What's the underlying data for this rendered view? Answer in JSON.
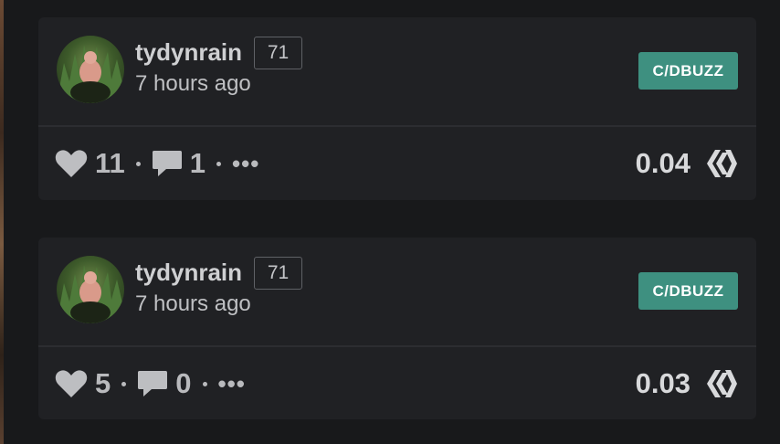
{
  "posts": [
    {
      "author": "tydynrain",
      "reputation": "71",
      "time": "7 hours ago",
      "community": "C/DBUZZ",
      "likes": "11",
      "comments": "1",
      "more": "•••",
      "payout": "0.04"
    },
    {
      "author": "tydynrain",
      "reputation": "71",
      "time": "7 hours ago",
      "community": "C/DBUZZ",
      "likes": "5",
      "comments": "0",
      "more": "•••",
      "payout": "0.03"
    }
  ],
  "icons": {
    "like": "heart-icon",
    "comment": "comment-icon",
    "more": "more-icon",
    "currency": "hive-icon"
  },
  "colors": {
    "background": "#18191b",
    "card": "#202124",
    "community_badge": "#3e9080",
    "text": "#cfd0d2"
  }
}
